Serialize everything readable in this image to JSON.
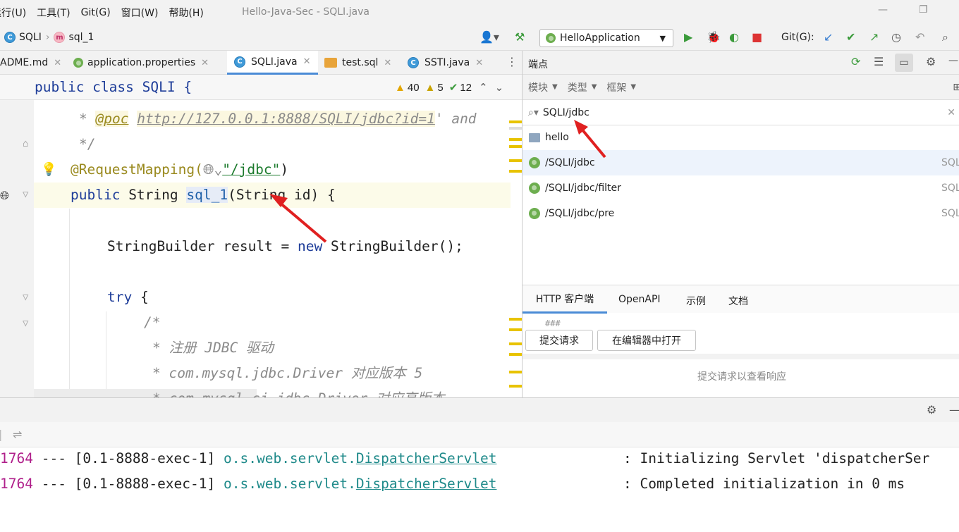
{
  "menubar": {
    "items": [
      "运行(U)",
      "工具(T)",
      "Git(G)",
      "窗口(W)",
      "帮助(H)"
    ],
    "window_title": "Hello-Java-Sec - SQLI.java"
  },
  "navbar": {
    "breadcrumb_class": "SQLI",
    "breadcrumb_method": "sql_1",
    "class_badge": "C",
    "method_badge": "m",
    "run_config": "HelloApplication",
    "git_label": "Git(G):"
  },
  "tabs": [
    {
      "label": "ADME.md"
    },
    {
      "label": "application.properties"
    },
    {
      "label": "SQLI.java"
    },
    {
      "label": "test.sql"
    },
    {
      "label": "SSTI.java"
    }
  ],
  "editor": {
    "header_code": "public class SQLI {",
    "warnings": "40",
    "weak_warnings": "5",
    "typos": "12",
    "lines": {
      "l1_star": "* ",
      "l1_tag": "@poc",
      "l1_url": "http://127.0.0.1:8888/SQLI/jdbc?id=1",
      "l1_rest": "' and",
      "l2": "*/",
      "l3_annot": "@RequestMapping(",
      "l3_path": "\"/jdbc\"",
      "l3_end": ")",
      "l4_kw": "public",
      "l4_type": " String ",
      "l4_method": "sql_1",
      "l4_rest": "(String id) {",
      "l5_a": "StringBuilder result = ",
      "l5_new": "new",
      "l5_b": " StringBuilder();",
      "l6_try": "try",
      "l6_rest": " {",
      "l7": "/*",
      "l8": "* 注册 JDBC 驱动",
      "l9": "* com.mysql.jdbc.Driver 对应版本 5",
      "l10": "* com.mysql.cj.jdbc.Driver 对应高版本"
    }
  },
  "endpoints": {
    "title": "端点",
    "filters": [
      "模块",
      "类型",
      "框架"
    ],
    "search_value": "SQLI/jdbc",
    "group": "hello",
    "items": [
      {
        "path": "/SQLI/jdbc",
        "module": "SQL"
      },
      {
        "path": "/SQLI/jdbc/filter",
        "module": "SQL"
      },
      {
        "path": "/SQLI/jdbc/pre",
        "module": "SQL"
      }
    ],
    "bottom_tabs": [
      "HTTP 客户端",
      "OpenAPI",
      "示例",
      "文档"
    ],
    "http_placeholder": "###",
    "submit_label": "提交请求",
    "open_in_editor_label": "在编辑器中打开",
    "response_hint": "提交请求以查看响应"
  },
  "console": {
    "lines": [
      {
        "pid": "1764",
        "sep": " --- ",
        "thread": "[0.1-8888-exec-1]",
        "logger_pkg": "o.s.web.servlet.",
        "logger_cls": "DispatcherServlet",
        "message": ": Initializing Servlet 'dispatcherSer"
      },
      {
        "pid": "1764",
        "sep": " --- ",
        "thread": "[0.1-8888-exec-1]",
        "logger_pkg": "o.s.web.servlet.",
        "logger_cls": "DispatcherServlet",
        "message": ": Completed initialization in 0 ms"
      }
    ]
  },
  "colors": {
    "accent": "#4a8bd6",
    "keyword": "#1e3d99",
    "annotation_arrow": "#e02020",
    "log_pid": "#b0208b",
    "log_logger": "#1f8a8a"
  }
}
